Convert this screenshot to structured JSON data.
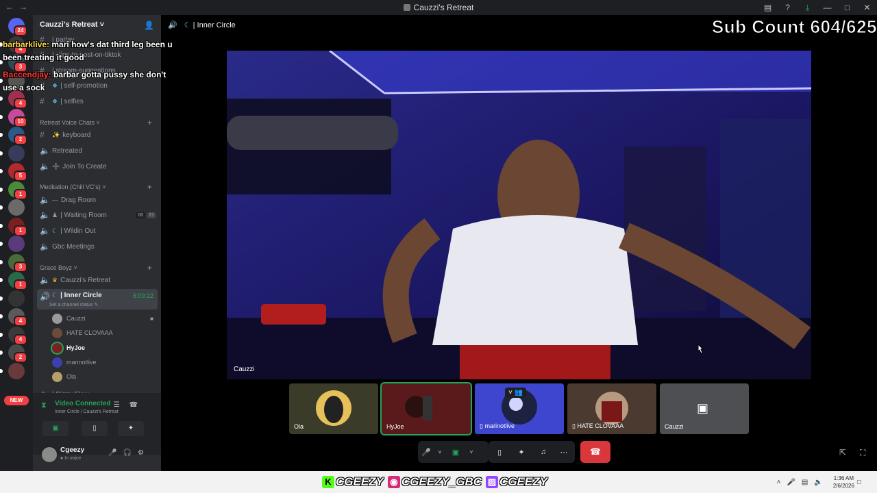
{
  "window": {
    "title": "Cauzzi's Retreat"
  },
  "server": {
    "name": "Cauzzi's Retreat"
  },
  "guild_badges": [
    "24",
    "4",
    "3",
    "",
    "4",
    "10",
    "2",
    "",
    "5",
    "1",
    "",
    "1",
    "",
    "3",
    "1",
    "",
    "4",
    "4",
    "2",
    ""
  ],
  "new_badge": "NEW",
  "channels": [
    {
      "name": "| parlay"
    },
    {
      "name": "| clips-to-post-on-tiktok"
    },
    {
      "name": "| stream-suggestions"
    },
    {
      "name": "| self-promotion"
    },
    {
      "name": "| selfies"
    }
  ],
  "categories": {
    "voice": "Retreat Voice Chats",
    "meditation": "Meditation (Chill VC's)",
    "grace": "Grace Boyz"
  },
  "voice_channels": {
    "keyboard": "keyboard",
    "retreated": "Retreated",
    "join": "Join To Create",
    "drag": "Drag Room",
    "waiting": "| Waiting Room",
    "waiting_counts": [
      "00",
      "21"
    ],
    "wildin": "| Wildin Out",
    "gbc": "Gbc Meetings",
    "cauzzis": "Cauzzi's Retreat",
    "inner": "| Inner Circle",
    "inner_time": "6:09:22",
    "inner_status": "Set a channel status",
    "next": "| Dizzy Flow"
  },
  "members": [
    "Cauzzi",
    "HATE CLOVAAA",
    "HyJoe",
    "marinotlive",
    "Ola"
  ],
  "voice_status": {
    "title": "Video Connected",
    "subtitle": "Inner Circle / Cauzzi's Retreat"
  },
  "user": {
    "name": "Cgeezy",
    "status": "In voice"
  },
  "stage": {
    "channel": "| Inner Circle",
    "main_label": "Cauzzi"
  },
  "sub_count": "Sub Count 604/625",
  "tiles": [
    {
      "name": "Ola"
    },
    {
      "name": "HyJoe"
    },
    {
      "name": "marinotlive"
    },
    {
      "name": "HATE CLOVAAA"
    },
    {
      "name": "Cauzzi"
    }
  ],
  "chat": [
    {
      "user": "barbarklive:",
      "text": " mari how's dat third leg been u",
      "cont": "been treating it good"
    },
    {
      "user": "Baccendjay:",
      "text": " barbar gotta pussy she don't",
      "cont": "use a sock"
    }
  ],
  "socials": [
    "CGEEZY",
    "CGEEZY_GBC",
    "CGEEZY"
  ],
  "clock": {
    "time": "1:36 AM",
    "date": "2/6/2026"
  },
  "colors": {
    "accent_green": "#23a55a",
    "danger": "#da373c",
    "blurple": "#5865f2"
  }
}
